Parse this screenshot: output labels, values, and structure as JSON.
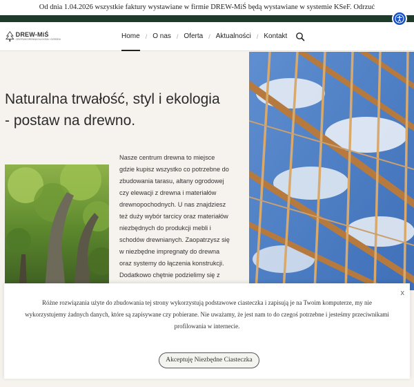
{
  "notice": {
    "text": "Od dnia 1.04.2026 wszystkie faktury wystawiane w firmie DREW-MiŚ będą wystawiane w systemie KSeF.",
    "dismiss_label": "Odrzuć"
  },
  "logo": {
    "title": "DREW-MiŚ",
    "subtitle": "CENTRUM DREWNA DLA DOMU I OGRODU"
  },
  "nav": {
    "items": [
      "Home",
      "O nas",
      "Oferta",
      "Aktualności",
      "Kontakt"
    ],
    "active": "Home"
  },
  "hero": {
    "title": "Naturalna trwałość, styl i ekologia - postaw na drewno."
  },
  "body": {
    "text": "Nasze centrum drewna to miejsce gdzie kupisz wszystko co potrzebne do zbudowania tarasu, altany ogrodowej czy elewacji z drewna i materiałów drewnopochodnych. U nas znajdziesz też duży wybór tarcicy oraz materiałów niezbędnych do produkcji mebli i schodów drewnianych. Zaopatrzysz się w niezbędne impregnaty do drewna oraz systemy do łączenia konstrukcji. Dodatkowo chętnie podzielimy się z"
  },
  "cookie": {
    "text": "Różne rozwiązania użyte do zbudowania tej strony wykorzystują podstawowe ciasteczka i zapisują je na Twoim komputerze, my nie wykorzystujemy żadnych danych, które są zapisywane czy pobierane. Nie uważamy, że jest nam to do czegoś potrzebne i jesteśmy przeciwnikami profilowania w internecie.",
    "button_label": "Akceptuję Niezbędne Ciasteczka",
    "close_label": "x"
  },
  "icons": {
    "accessibility": "accessibility-icon",
    "search": "search-icon",
    "logo": "tree-logo-icon"
  },
  "colors": {
    "dark_strip": "#1e3a2a",
    "accessibility": "#1450c8",
    "page_bg": "#f6f3ee"
  }
}
